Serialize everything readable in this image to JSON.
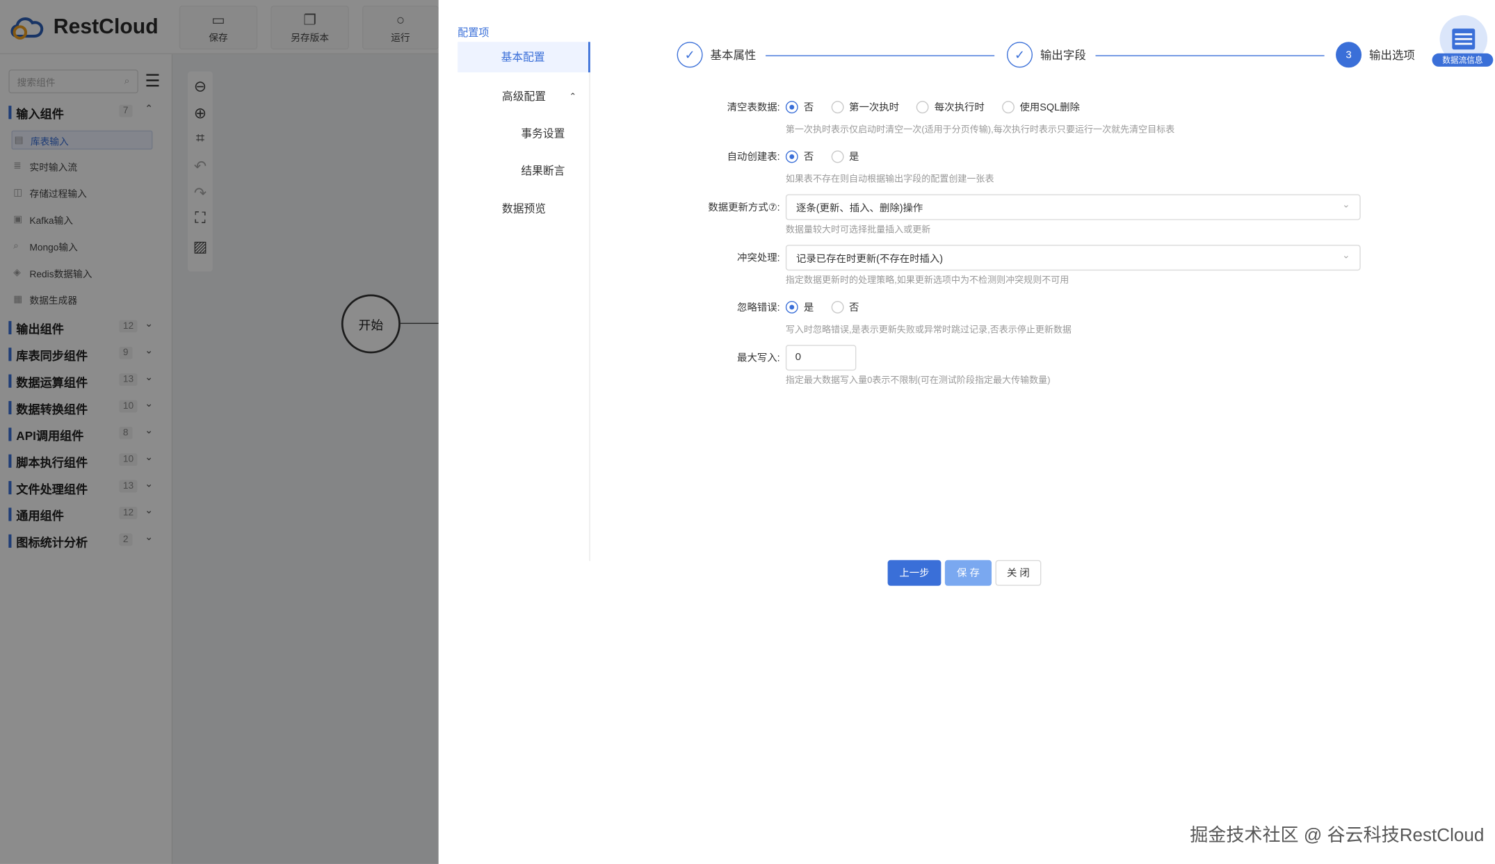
{
  "app": {
    "brand": "RestCloud",
    "toolbar": [
      {
        "label": "保存",
        "icon": "save-icon"
      },
      {
        "label": "另存版本",
        "icon": "copy-icon"
      },
      {
        "label": "运行",
        "icon": "run-icon"
      }
    ]
  },
  "sidebar": {
    "search_placeholder": "搜索组件",
    "groups": [
      {
        "label": "输入组件",
        "count": "7",
        "chevron": "⌃"
      },
      {
        "label": "输出组件",
        "count": "12",
        "chevron": "⌄"
      },
      {
        "label": "库表同步组件",
        "count": "9",
        "chevron": "⌄"
      },
      {
        "label": "数据运算组件",
        "count": "13",
        "chevron": "⌄"
      },
      {
        "label": "数据转换组件",
        "count": "10",
        "chevron": "⌄"
      },
      {
        "label": "API调用组件",
        "count": "8",
        "chevron": "⌄"
      },
      {
        "label": "脚本执行组件",
        "count": "10",
        "chevron": "⌄"
      },
      {
        "label": "文件处理组件",
        "count": "13",
        "chevron": "⌄"
      },
      {
        "label": "通用组件",
        "count": "12",
        "chevron": "⌄"
      },
      {
        "label": "图标统计分析",
        "count": "2",
        "chevron": "⌄"
      }
    ],
    "input_items": [
      "库表输入",
      "实时输入流",
      "存储过程输入",
      "Kafka输入",
      "Mongo输入",
      "Redis数据输入",
      "数据生成器"
    ]
  },
  "canvas": {
    "start_node": "开始"
  },
  "drawer": {
    "title": "配置项",
    "menu": [
      "基本配置",
      "高级配置",
      "事务设置",
      "结果断言",
      "数据预览"
    ],
    "steps": [
      {
        "label": "基本属性",
        "mark": "✓"
      },
      {
        "label": "输出字段",
        "mark": "✓"
      },
      {
        "label": "输出选项",
        "mark": "3"
      }
    ],
    "form": {
      "clear": {
        "label": "清空表数据:",
        "options": [
          "否",
          "第一次执时",
          "每次执行时",
          "使用SQL删除"
        ],
        "help": "第一次执时表示仅启动时清空一次(适用于分页传输),每次执行时表示只要运行一次就先清空目标表"
      },
      "autocreate": {
        "label": "自动创建表:",
        "options": [
          "否",
          "是"
        ],
        "help": "如果表不存在则自动根据输出字段的配置创建一张表"
      },
      "update_mode": {
        "label": "数据更新方式⑦:",
        "value": "逐条(更新、插入、删除)操作",
        "help": "数据量较大时可选择批量插入或更新"
      },
      "conflict": {
        "label": "冲突处理:",
        "value": "记录已存在时更新(不存在时插入)",
        "help": "指定数据更新时的处理策略,如果更新选项中为不检测则冲突规则不可用"
      },
      "ignore": {
        "label": "忽略错误:",
        "options": [
          "是",
          "否"
        ],
        "help": "写入时忽略错误,是表示更新失败或异常时跳过记录,否表示停止更新数据"
      },
      "max_write": {
        "label": "最大写入:",
        "value": "0",
        "help": "指定最大数据写入量0表示不限制(可在测试阶段指定最大传输数量)"
      }
    },
    "buttons": {
      "prev": "上一步",
      "save": "保 存",
      "close": "关 闭"
    },
    "badge": "数据流信息"
  },
  "watermark": "掘金技术社区 @ 谷云科技RestCloud",
  "colors": {
    "accent": "#3a6fd8",
    "save_button": "#7aa8f0",
    "overlay": "rgba(0,0,0,0.45)"
  }
}
